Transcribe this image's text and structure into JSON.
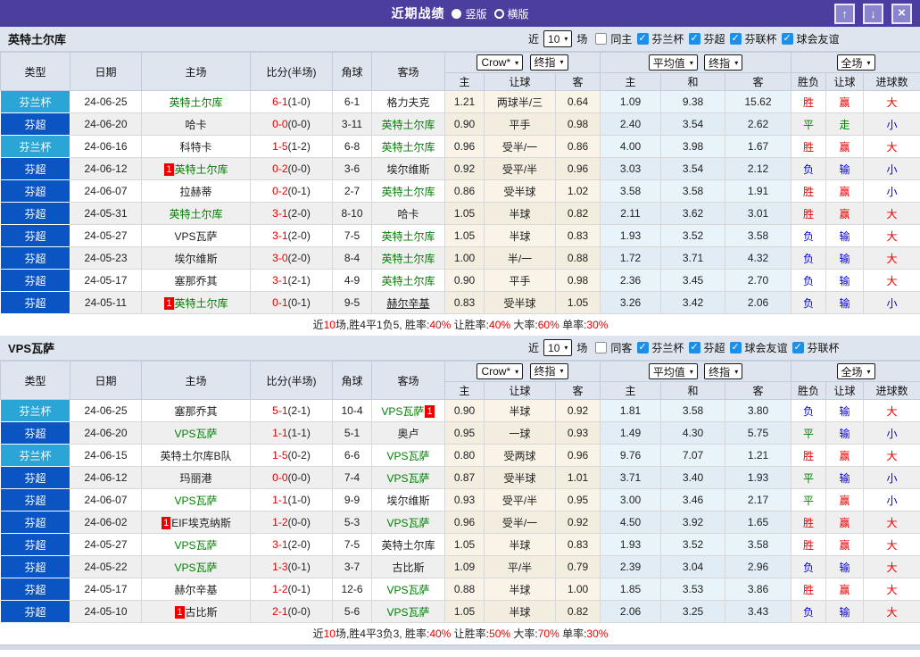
{
  "titlebar": {
    "title": "近期战绩",
    "vertical_label": "竖版",
    "horizontal_label": "横版",
    "up_icon": "↑",
    "down_icon": "↓",
    "close_icon": "×"
  },
  "filters": {
    "prefix": "近",
    "suffix": "场"
  },
  "header": {
    "type": "类型",
    "date": "日期",
    "home": "主场",
    "score": "比分(半场)",
    "corners": "角球",
    "away": "客场",
    "crow_select": "Crow*",
    "final_select": "终指",
    "avg_select": "平均值",
    "final_select2": "终指",
    "full_select": "全场",
    "sub_home": "主",
    "sub_handicap": "让球",
    "sub_away": "客",
    "sub_home2": "主",
    "sub_draw": "和",
    "sub_away2": "客",
    "sub_wdl": "胜负",
    "sub_handicap2": "让球",
    "sub_goals": "进球数"
  },
  "colors": {
    "titlebar_bg": "#4b3e9e",
    "league_cup": "#2aa5d5",
    "league_super": "#0a55c3",
    "result_red": "#e60000",
    "result_blue": "#0000dd",
    "result_green": "#008000",
    "focal_team_green": "#008000"
  },
  "tables": [
    {
      "team": "英特土尔库",
      "match_count": "10",
      "same_label": "同主",
      "leagues": [
        "芬兰杯",
        "芬超",
        "芬联杯",
        "球会友谊"
      ],
      "rows": [
        {
          "league": "芬兰杯",
          "date": "24-06-25",
          "home": "英特土尔库",
          "score": "6-1",
          "half": "(1-0)",
          "corners": "6-1",
          "away": "格力夫克",
          "crow": [
            "1.21",
            "两球半/三",
            "0.64"
          ],
          "avg": [
            "1.09",
            "9.38",
            "15.62"
          ],
          "results": [
            "胜",
            "赢",
            "大"
          ]
        },
        {
          "league": "芬超",
          "date": "24-06-20",
          "home": "哈卡",
          "score": "0-0",
          "half": "(0-0)",
          "corners": "3-11",
          "away": "英特土尔库",
          "crow": [
            "0.90",
            "平手",
            "0.98"
          ],
          "avg": [
            "2.40",
            "3.54",
            "2.62"
          ],
          "results": [
            "平",
            "走",
            "小"
          ]
        },
        {
          "league": "芬兰杯",
          "date": "24-06-16",
          "home": "科特卡",
          "score": "1-5",
          "half": "(1-2)",
          "corners": "6-8",
          "away": "英特土尔库",
          "crow": [
            "0.96",
            "受半/一",
            "0.86"
          ],
          "avg": [
            "4.00",
            "3.98",
            "1.67"
          ],
          "results": [
            "胜",
            "赢",
            "大"
          ]
        },
        {
          "league": "芬超",
          "date": "24-06-12",
          "home": "英特土尔库",
          "home_badge": "1",
          "score": "0-2",
          "half": "(0-0)",
          "corners": "3-6",
          "away": "埃尔维斯",
          "crow": [
            "0.92",
            "受平/半",
            "0.96"
          ],
          "avg": [
            "3.03",
            "3.54",
            "2.12"
          ],
          "results": [
            "负",
            "输",
            "小"
          ]
        },
        {
          "league": "芬超",
          "date": "24-06-07",
          "home": "拉赫蒂",
          "score": "0-2",
          "half": "(0-1)",
          "corners": "2-7",
          "away": "英特土尔库",
          "crow": [
            "0.86",
            "受半球",
            "1.02"
          ],
          "avg": [
            "3.58",
            "3.58",
            "1.91"
          ],
          "results": [
            "胜",
            "赢",
            "小"
          ]
        },
        {
          "league": "芬超",
          "date": "24-05-31",
          "home": "英特土尔库",
          "score": "3-1",
          "half": "(2-0)",
          "corners": "8-10",
          "away": "哈卡",
          "crow": [
            "1.05",
            "半球",
            "0.82"
          ],
          "avg": [
            "2.11",
            "3.62",
            "3.01"
          ],
          "results": [
            "胜",
            "赢",
            "大"
          ]
        },
        {
          "league": "芬超",
          "date": "24-05-27",
          "home": "VPS瓦萨",
          "score": "3-1",
          "half": "(2-0)",
          "corners": "7-5",
          "away": "英特土尔库",
          "crow": [
            "1.05",
            "半球",
            "0.83"
          ],
          "avg": [
            "1.93",
            "3.52",
            "3.58"
          ],
          "results": [
            "负",
            "输",
            "大"
          ]
        },
        {
          "league": "芬超",
          "date": "24-05-23",
          "home": "埃尔维斯",
          "score": "3-0",
          "half": "(2-0)",
          "corners": "8-4",
          "away": "英特土尔库",
          "crow": [
            "1.00",
            "半/一",
            "0.88"
          ],
          "avg": [
            "1.72",
            "3.71",
            "4.32"
          ],
          "results": [
            "负",
            "输",
            "大"
          ]
        },
        {
          "league": "芬超",
          "date": "24-05-17",
          "home": "塞那乔其",
          "score": "3-1",
          "half": "(2-1)",
          "corners": "4-9",
          "away": "英特土尔库",
          "crow": [
            "0.90",
            "平手",
            "0.98"
          ],
          "avg": [
            "2.36",
            "3.45",
            "2.70"
          ],
          "results": [
            "负",
            "输",
            "大"
          ]
        },
        {
          "league": "芬超",
          "date": "24-05-11",
          "home": "英特土尔库",
          "home_badge": "1",
          "score": "0-1",
          "half": "(0-1)",
          "corners": "9-5",
          "away": "赫尔辛基",
          "away_underline": true,
          "crow": [
            "0.83",
            "受半球",
            "1.05"
          ],
          "avg": [
            "3.26",
            "3.42",
            "2.06"
          ],
          "results": [
            "负",
            "输",
            "小"
          ]
        }
      ],
      "summary": [
        [
          "近",
          0
        ],
        [
          "10",
          1
        ],
        [
          "场,胜4平1负5, 胜率:",
          0
        ],
        [
          "40%",
          1
        ],
        [
          " 让胜率:",
          0
        ],
        [
          "40%",
          1
        ],
        [
          " 大率:",
          0
        ],
        [
          "60%",
          1
        ],
        [
          " 单率:",
          0
        ],
        [
          "30%",
          1
        ]
      ]
    },
    {
      "team": "VPS瓦萨",
      "match_count": "10",
      "same_label": "同客",
      "leagues": [
        "芬兰杯",
        "芬超",
        "球会友谊",
        "芬联杯"
      ],
      "rows": [
        {
          "league": "芬兰杯",
          "date": "24-06-25",
          "home": "塞那乔其",
          "score": "5-1",
          "half": "(2-1)",
          "corners": "10-4",
          "away": "VPS瓦萨",
          "away_badge": "1",
          "away_badge_pos": "after",
          "crow": [
            "0.90",
            "半球",
            "0.92"
          ],
          "avg": [
            "1.81",
            "3.58",
            "3.80"
          ],
          "results": [
            "负",
            "输",
            "大"
          ]
        },
        {
          "league": "芬超",
          "date": "24-06-20",
          "home": "VPS瓦萨",
          "score": "1-1",
          "half": "(1-1)",
          "corners": "5-1",
          "away": "奥卢",
          "crow": [
            "0.95",
            "一球",
            "0.93"
          ],
          "avg": [
            "1.49",
            "4.30",
            "5.75"
          ],
          "results": [
            "平",
            "输",
            "小"
          ]
        },
        {
          "league": "芬兰杯",
          "date": "24-06-15",
          "home": "英特土尔库B队",
          "score": "1-5",
          "half": "(0-2)",
          "corners": "6-6",
          "away": "VPS瓦萨",
          "crow": [
            "0.80",
            "受两球",
            "0.96"
          ],
          "avg": [
            "9.76",
            "7.07",
            "1.21"
          ],
          "results": [
            "胜",
            "赢",
            "大"
          ]
        },
        {
          "league": "芬超",
          "date": "24-06-12",
          "home": "玛丽港",
          "score": "0-0",
          "half": "(0-0)",
          "corners": "7-4",
          "away": "VPS瓦萨",
          "crow": [
            "0.87",
            "受半球",
            "1.01"
          ],
          "avg": [
            "3.71",
            "3.40",
            "1.93"
          ],
          "results": [
            "平",
            "输",
            "小"
          ]
        },
        {
          "league": "芬超",
          "date": "24-06-07",
          "home": "VPS瓦萨",
          "score": "1-1",
          "half": "(1-0)",
          "corners": "9-9",
          "away": "埃尔维斯",
          "crow": [
            "0.93",
            "受平/半",
            "0.95"
          ],
          "avg": [
            "3.00",
            "3.46",
            "2.17"
          ],
          "results": [
            "平",
            "赢",
            "小"
          ]
        },
        {
          "league": "芬超",
          "date": "24-06-02",
          "home": "EIF埃克纳斯",
          "home_badge": "1",
          "score": "1-2",
          "half": "(0-0)",
          "corners": "5-3",
          "away": "VPS瓦萨",
          "crow": [
            "0.96",
            "受半/一",
            "0.92"
          ],
          "avg": [
            "4.50",
            "3.92",
            "1.65"
          ],
          "results": [
            "胜",
            "赢",
            "大"
          ]
        },
        {
          "league": "芬超",
          "date": "24-05-27",
          "home": "VPS瓦萨",
          "score": "3-1",
          "half": "(2-0)",
          "corners": "7-5",
          "away": "英特土尔库",
          "crow": [
            "1.05",
            "半球",
            "0.83"
          ],
          "avg": [
            "1.93",
            "3.52",
            "3.58"
          ],
          "results": [
            "胜",
            "赢",
            "大"
          ]
        },
        {
          "league": "芬超",
          "date": "24-05-22",
          "home": "VPS瓦萨",
          "score": "1-3",
          "half": "(0-1)",
          "corners": "3-7",
          "away": "古比斯",
          "crow": [
            "1.09",
            "平/半",
            "0.79"
          ],
          "avg": [
            "2.39",
            "3.04",
            "2.96"
          ],
          "results": [
            "负",
            "输",
            "大"
          ]
        },
        {
          "league": "芬超",
          "date": "24-05-17",
          "home": "赫尔辛基",
          "score": "1-2",
          "half": "(0-1)",
          "corners": "12-6",
          "away": "VPS瓦萨",
          "crow": [
            "0.88",
            "半球",
            "1.00"
          ],
          "avg": [
            "1.85",
            "3.53",
            "3.86"
          ],
          "results": [
            "胜",
            "赢",
            "大"
          ]
        },
        {
          "league": "芬超",
          "date": "24-05-10",
          "home": "古比斯",
          "home_badge": "1",
          "score": "2-1",
          "half": "(0-0)",
          "corners": "5-6",
          "away": "VPS瓦萨",
          "crow": [
            "1.05",
            "半球",
            "0.82"
          ],
          "avg": [
            "2.06",
            "3.25",
            "3.43"
          ],
          "results": [
            "负",
            "输",
            "大"
          ]
        }
      ],
      "summary": [
        [
          "近",
          0
        ],
        [
          "10",
          1
        ],
        [
          "场,胜4平3负3, 胜率:",
          0
        ],
        [
          "40%",
          1
        ],
        [
          " 让胜率:",
          0
        ],
        [
          "50%",
          1
        ],
        [
          " 大率:",
          0
        ],
        [
          "70%",
          1
        ],
        [
          " 单率:",
          0
        ],
        [
          "30%",
          1
        ]
      ]
    }
  ]
}
